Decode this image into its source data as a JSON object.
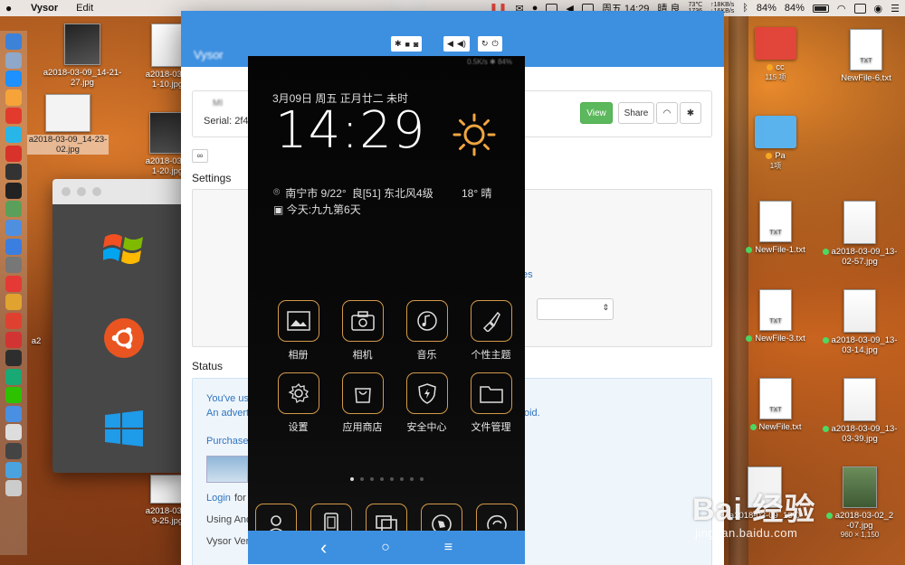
{
  "menubar": {
    "app_name": "Vysor",
    "menu_edit": "Edit",
    "clock": "周五 14:29",
    "weather": "晴 良",
    "temp_cpu": "73℃",
    "fan": "1736",
    "net_up": "↑18KB/s",
    "net_down": "↓16KB/s",
    "battery1": "84%",
    "battery2": "84%",
    "count": "15 项"
  },
  "desktop": {
    "files_left": [
      {
        "name": "a2018-03-09_14-21-27.jpg"
      },
      {
        "name": "a2018-03-09_14-23-02.jpg"
      },
      {
        "name": "a2018-03-0\n1-10.jpg"
      },
      {
        "name": "a2018-03-0\n1-20.jpg"
      },
      {
        "name": "a2"
      },
      {
        "name": "a2018-03-0\n9-25.jpg"
      }
    ],
    "files_right": [
      {
        "name": "cc",
        "sub": "115 项"
      },
      {
        "name": "NewFile-6.txt"
      },
      {
        "name": "Pa",
        "sub": "1项"
      },
      {
        "name": "NewFile-1.txt"
      },
      {
        "name": "a2018-03-09_13-02-57.jpg"
      },
      {
        "name": "NewFile-3.txt"
      },
      {
        "name": "a2018-03-09_13-03-14.jpg"
      },
      {
        "name": "NewFile.txt"
      },
      {
        "name": "a2018-03-09_13-03-39.jpg"
      },
      {
        "name": "a2018-03-09_13-0"
      },
      {
        "name": "a2018-03-02_2\n-07.jpg",
        "sub": "960 × 1,150"
      }
    ]
  },
  "vysor": {
    "header_title": "Vysor",
    "device_name": "MI",
    "serial": "Serial: 2f4",
    "view_label": "View",
    "share_label": "Share",
    "settings_title": "Settings",
    "settings_hint": "es",
    "status_title": "Status",
    "status_line1": "You've us",
    "status_line2": "An advert",
    "status_line2_tail": "oid.",
    "purchase": "Purchase",
    "login": "Login",
    "login_tail": "for",
    "using": "Using And",
    "version": "Vysor Ver"
  },
  "phone": {
    "status": "0.5K/s ✱ 84%",
    "date_line": "3月09日 周五 正月廿二 未时",
    "time": "14:29",
    "location": "南宁市 9/22°",
    "air": "良[51] 东北风4级",
    "temp": "18°   晴",
    "today": "今天:九九第6天",
    "apps": [
      {
        "label": "相册"
      },
      {
        "label": "相机"
      },
      {
        "label": "音乐"
      },
      {
        "label": "个性主题"
      },
      {
        "label": "设置"
      },
      {
        "label": "应用商店"
      },
      {
        "label": "安全中心"
      },
      {
        "label": "文件管理"
      }
    ],
    "nav_back": "‹",
    "nav_home": "○",
    "nav_menu": "≡"
  },
  "watermark": {
    "text": "Bai 经验",
    "url": "jingyan.baidu.com"
  },
  "colors": {
    "vysor_blue": "#3d8fe0",
    "view_green": "#5cb85c",
    "gold": "#d39a4a"
  }
}
